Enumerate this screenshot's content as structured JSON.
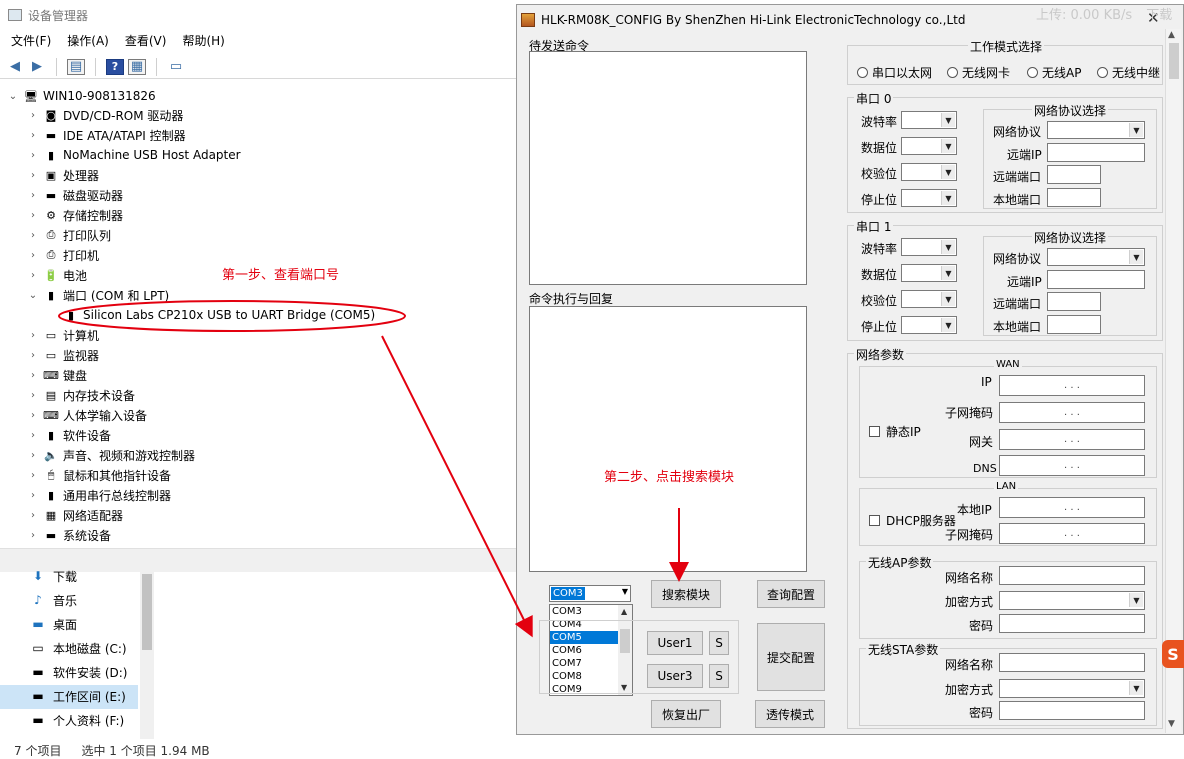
{
  "device_manager": {
    "title": "设备管理器",
    "menu": [
      "文件(F)",
      "操作(A)",
      "查看(V)",
      "帮助(H)"
    ],
    "root": "WIN10-908131826",
    "categories": [
      "DVD/CD-ROM 驱动器",
      "IDE ATA/ATAPI 控制器",
      "NoMachine USB Host Adapter",
      "处理器",
      "磁盘驱动器",
      "存储控制器",
      "打印队列",
      "打印机",
      "电池",
      "端口 (COM 和 LPT)",
      "Silicon Labs CP210x USB to UART Bridge (COM5)",
      "计算机",
      "监视器",
      "键盘",
      "内存技术设备",
      "人体学输入设备",
      "软件设备",
      "声音、视频和游戏控制器",
      "鼠标和其他指针设备",
      "通用串行总线控制器",
      "网络适配器",
      "系统设备"
    ]
  },
  "explorer": {
    "items": [
      "下载",
      "音乐",
      "桌面",
      "本地磁盘 (C:)",
      "软件安装 (D:)",
      "工作区间 (E:)",
      "个人资料 (F:)"
    ],
    "status_count": "7 个项目",
    "status_selected": "选中 1 个项目  1.94 MB"
  },
  "annotations": {
    "step1": "第一步、查看端口号",
    "step2": "第二步、点击搜索模块"
  },
  "overlay": {
    "upload": "上传: 0.00 KB/s",
    "download": "下载"
  },
  "config": {
    "title": "HLK-RM08K_CONFIG By ShenZhen Hi-Link ElectronicTechnology co.,Ltd",
    "close": "✕",
    "send_label": "待发送命令",
    "reply_label": "命令执行与回复",
    "com_selected": "COM3",
    "com_options": [
      "COM3",
      "COM4",
      "COM5",
      "COM6",
      "COM7",
      "COM8",
      "COM9"
    ],
    "com_active": "COM5",
    "buttons": {
      "search": "搜索模块",
      "query": "查询配置",
      "submit": "提交配置",
      "user1": "User1",
      "user3": "User3",
      "s1": "S",
      "s3": "S",
      "factory": "恢复出厂",
      "transparent": "透传模式"
    },
    "work_mode": {
      "title": "工作模式选择",
      "options": [
        "串口以太网",
        "无线网卡",
        "无线AP",
        "无线中继"
      ]
    },
    "serial0": {
      "title": "串口 0",
      "fields": [
        "波特率",
        "数据位",
        "校验位",
        "停止位"
      ],
      "net": {
        "title": "网络协议选择",
        "protocol": "网络协议",
        "remote_ip": "远端IP",
        "remote_port": "远端端口",
        "local_port": "本地端口"
      }
    },
    "serial1": {
      "title": "串口 1",
      "fields": [
        "波特率",
        "数据位",
        "校验位",
        "停止位"
      ],
      "net": {
        "title": "网络协议选择",
        "protocol": "网络协议",
        "remote_ip": "远端IP",
        "remote_port": "远端端口",
        "local_port": "本地端口"
      }
    },
    "network": {
      "title": "网络参数",
      "wan": {
        "title": "WAN",
        "static_ip": "静态IP",
        "ip": "IP",
        "mask": "子网掩码",
        "gateway": "网关",
        "dns": "DNS"
      },
      "lan": {
        "title": "LAN",
        "dhcp": "DHCP服务器",
        "local_ip": "本地IP",
        "mask": "子网掩码"
      }
    },
    "ap": {
      "title": "无线AP参数",
      "ssid": "网络名称",
      "encryption": "加密方式",
      "password": "密码"
    },
    "sta": {
      "title": "无线STA参数",
      "ssid": "网络名称",
      "encryption": "加密方式",
      "password": "密码"
    },
    "ip_dots": ".   .   ."
  }
}
